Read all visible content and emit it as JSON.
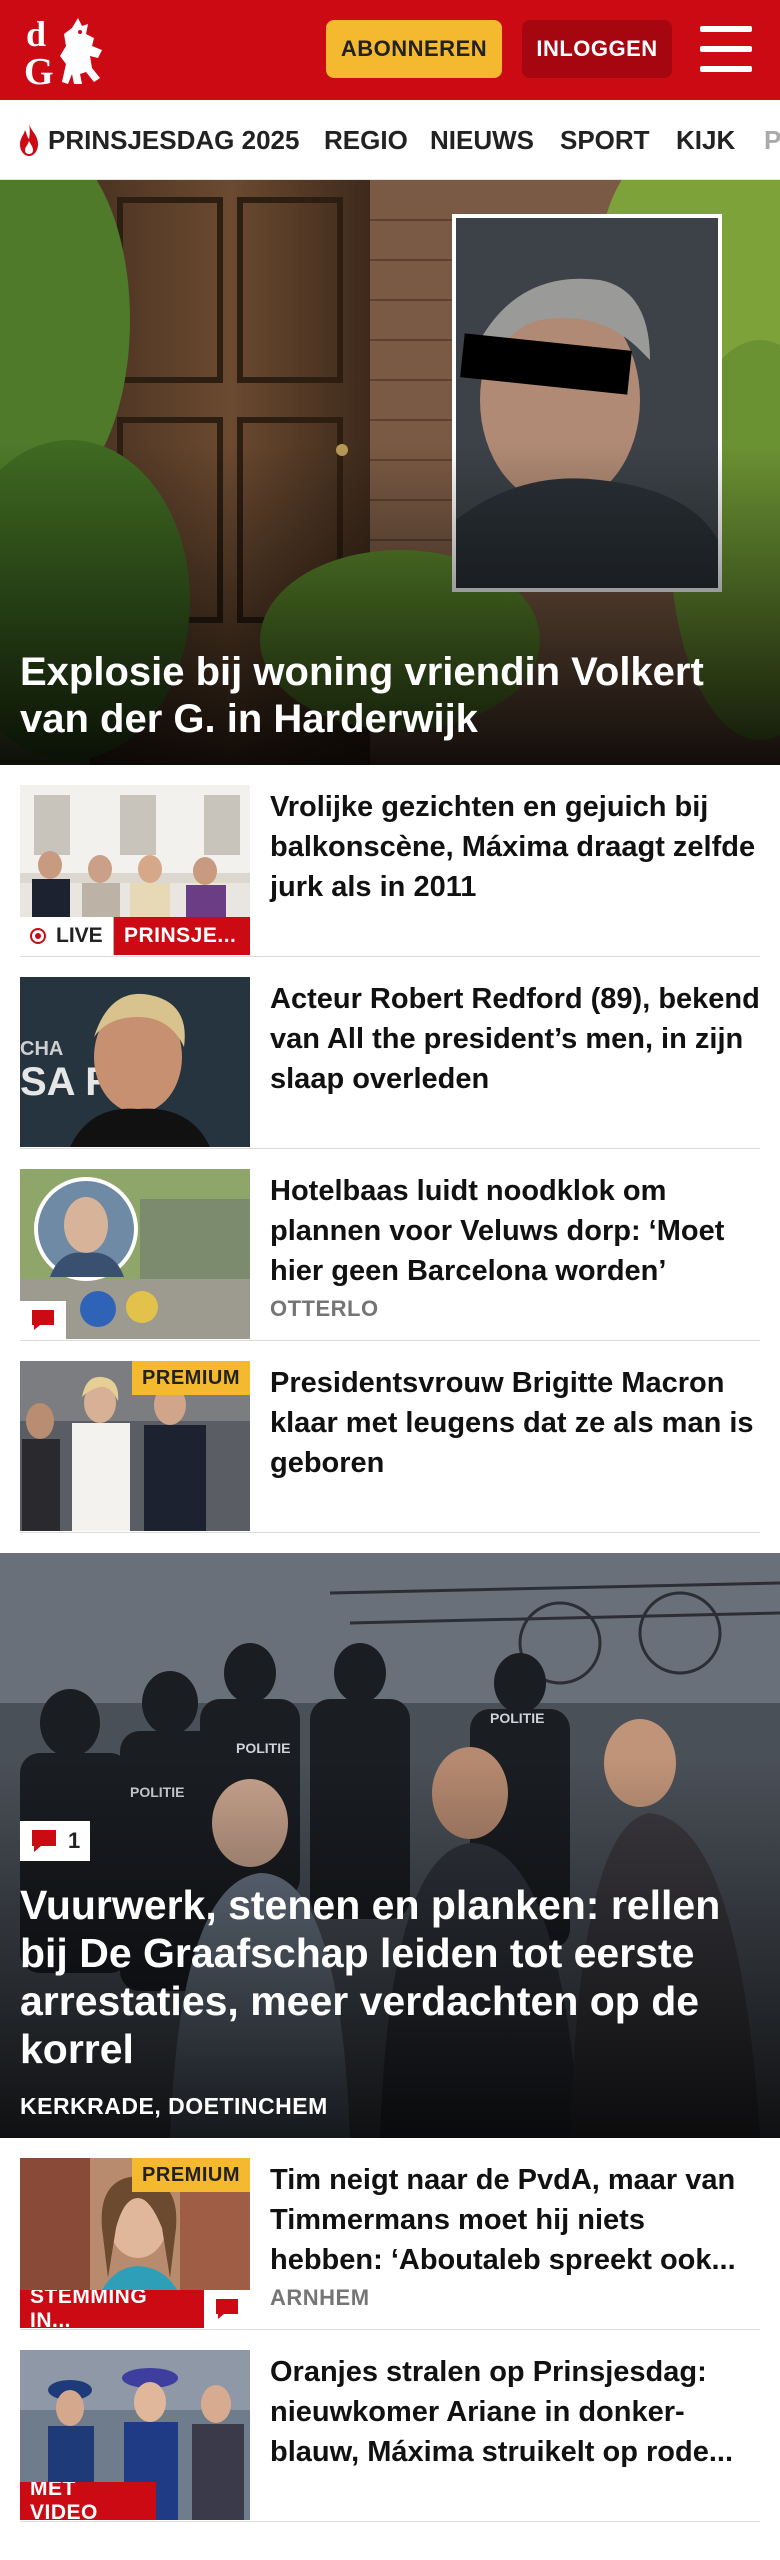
{
  "header": {
    "logo_text": "dG",
    "subscribe_label": "ABONNEREN",
    "login_label": "INLOGGEN",
    "brand_color": "#cc0a14",
    "menu_icon": "hamburger-icon"
  },
  "nav": {
    "items": [
      {
        "label": "PRINSJESDAG 2025",
        "icon": "flame-icon"
      },
      {
        "label": "REGIO"
      },
      {
        "label": "NIEUWS"
      },
      {
        "label": "SPORT"
      },
      {
        "label": "KIJK"
      },
      {
        "label": "P"
      }
    ]
  },
  "hero": {
    "title": "Explosie bij woning vriendin Volkert van der G. in Harderwijk"
  },
  "articles": [
    {
      "title": "Vrolijke gezichten en gejuich bij balkonscène, Máxima draagt zelfde jurk als in 2011",
      "live_label": "LIVE",
      "category_label": "PRINSJE..."
    },
    {
      "title": "Acteur Robert Redford (89), bekend van All the president’s men, in zijn slaap overleden"
    },
    {
      "title": "Hotelbaas luidt noodklok om plannen voor Veluws dorp: ‘Moet hier geen Barcelona worden’",
      "location": "OTTERLO",
      "comment_icon": "comment-icon"
    },
    {
      "title": "Presidentsvrouw Brigitte Macron klaar met leugens dat ze als man is geboren",
      "premium_label": "PREMIUM"
    }
  ],
  "big_story": {
    "comment_count": "1",
    "title": "Vuurwerk, stenen en planken: rellen bij De Graafschap leiden tot eerste arrestaties, meer verdachten op de korrel",
    "location": "KERKRADE, DOETINCHEM"
  },
  "articles2": [
    {
      "title": "Tim neigt naar de PvdA, maar van Timmermans moet hij niets hebben: ‘Aboutaleb spreekt ook...",
      "location": "ARNHEM",
      "premium_label": "PREMIUM",
      "category_label": "STEMMING IN..."
    },
    {
      "title": "Oranjes stralen op Prinsjesdag: nieuwkomer Ariane in donker-blauw, Máxima struikelt op rode...",
      "category_label": "MET VIDEO"
    }
  ]
}
